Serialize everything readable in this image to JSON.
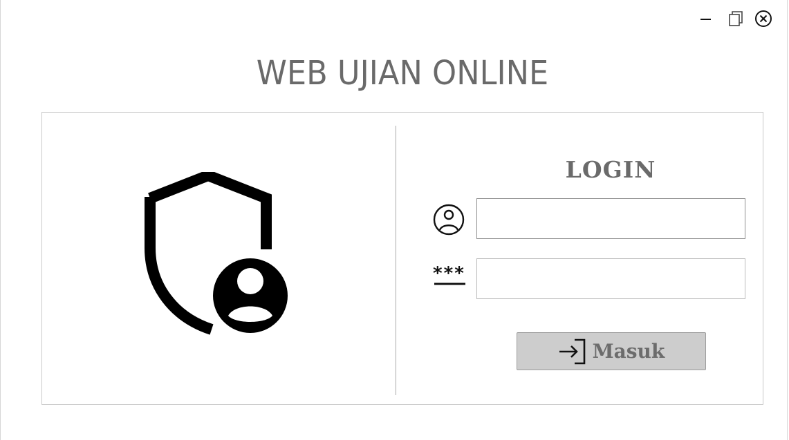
{
  "window": {
    "controls": {
      "minimize_icon": "minimize-icon",
      "maximize_icon": "restore-icon",
      "close_icon": "close-icon"
    }
  },
  "app_title": "WEB UJIAN ONLINE",
  "login": {
    "title": "LOGIN",
    "username_icon": "user-circle-icon",
    "password_icon": "password-asterisk-icon",
    "username_value": "",
    "password_value": "",
    "submit_label": "Masuk",
    "submit_icon": "login-arrow-icon"
  },
  "hero_icon": "shield-user-icon",
  "colors": {
    "title": "#6a6a6a",
    "button_bg": "#cdcdcd",
    "border": "#c8c8c8"
  }
}
